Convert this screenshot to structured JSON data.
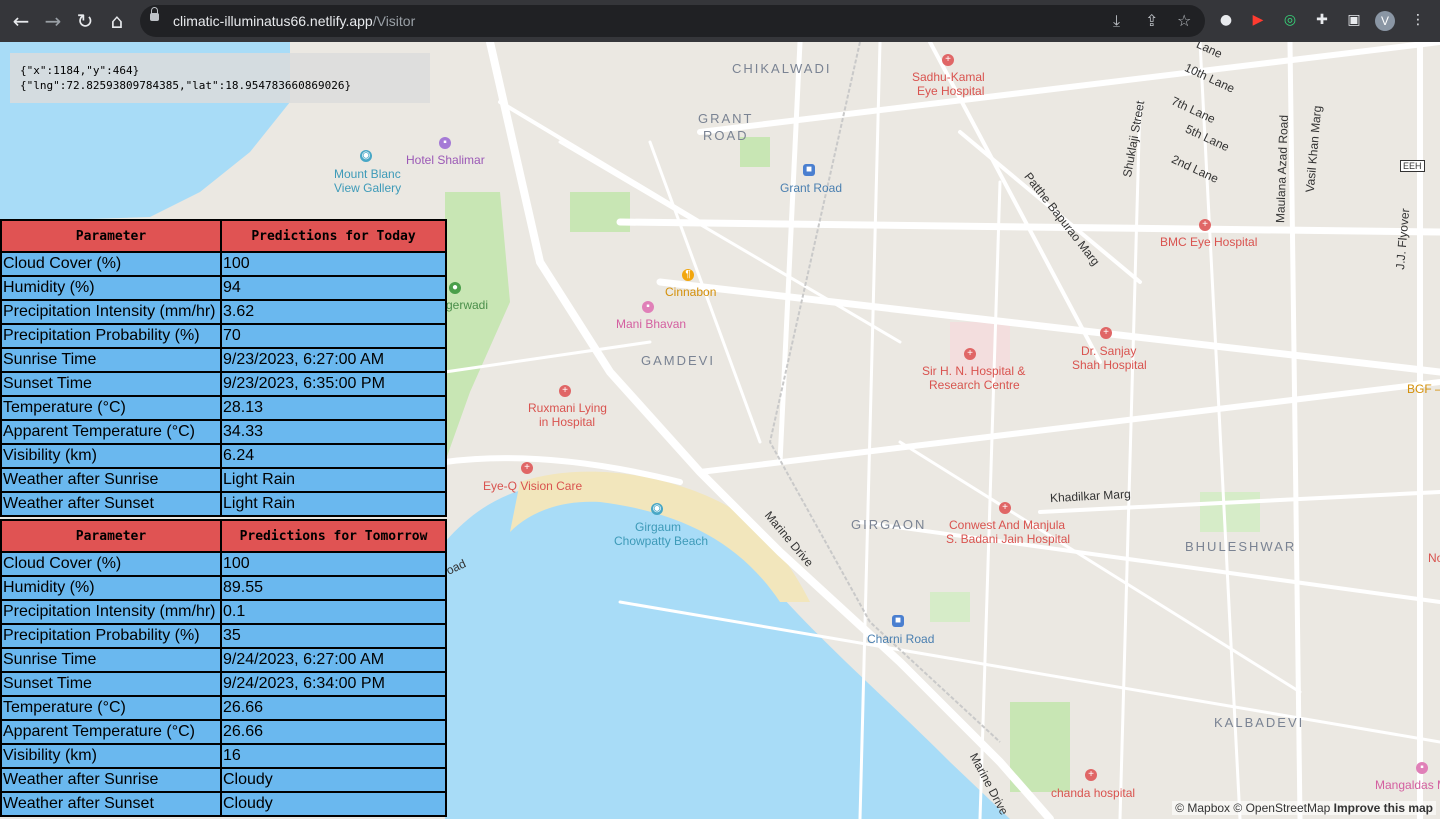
{
  "browser": {
    "url_host": "climatic-illuminatus66.netlify.app",
    "url_path": "/Visitor",
    "profile_initial": "V",
    "icons": [
      "back-icon",
      "forward-icon",
      "reload-icon",
      "home-icon",
      "install-icon",
      "share-icon",
      "star-icon",
      "extension-icon",
      "youtube-icon",
      "target-icon",
      "puzzle-icon",
      "sidepanel-icon",
      "menu-icon"
    ]
  },
  "coords": {
    "line1": "{\"x\":1184,\"y\":464}",
    "line2": "{\"lng\":72.82593809784385,\"lat\":18.954783660869026}"
  },
  "today": {
    "headers": [
      "Parameter",
      "Predictions for Today"
    ],
    "rows": [
      [
        "Cloud Cover (%)",
        "100"
      ],
      [
        "Humidity (%)",
        "94"
      ],
      [
        "Precipitation Intensity (mm/hr)",
        "3.62"
      ],
      [
        "Precipitation Probability (%)",
        "70"
      ],
      [
        "Sunrise Time",
        "9/23/2023, 6:27:00 AM"
      ],
      [
        "Sunset Time",
        "9/23/2023, 6:35:00 PM"
      ],
      [
        "Temperature (°C)",
        "28.13"
      ],
      [
        "Apparent Temperature (°C)",
        "34.33"
      ],
      [
        "Visibility (km)",
        "6.24"
      ],
      [
        "Weather after Sunrise",
        "Light Rain"
      ],
      [
        "Weather after Sunset",
        "Light Rain"
      ]
    ]
  },
  "tomorrow": {
    "headers": [
      "Parameter",
      "Predictions for Tomorrow"
    ],
    "rows": [
      [
        "Cloud Cover (%)",
        "100"
      ],
      [
        "Humidity (%)",
        "89.55"
      ],
      [
        "Precipitation Intensity (mm/hr)",
        "0.1"
      ],
      [
        "Precipitation Probability (%)",
        "35"
      ],
      [
        "Sunrise Time",
        "9/24/2023, 6:27:00 AM"
      ],
      [
        "Sunset Time",
        "9/24/2023, 6:34:00 PM"
      ],
      [
        "Temperature (°C)",
        "26.66"
      ],
      [
        "Apparent Temperature (°C)",
        "26.66"
      ],
      [
        "Visibility (km)",
        "16"
      ],
      [
        "Weather after Sunrise",
        "Cloudy"
      ],
      [
        "Weather after Sunset",
        "Cloudy"
      ]
    ]
  },
  "map": {
    "districts": [
      "CHIKALWADI",
      "GRANT",
      "ROAD",
      "GAMDEVI",
      "GIRGAON",
      "BHULESHWAR",
      "KALBADEVI"
    ],
    "pois": {
      "sadhu_kamal_1": "Sadhu-Kamal",
      "sadhu_kamal_2": "Eye Hospital",
      "hotel_shalimar": "Hotel Shalimar",
      "mount_blanc_1": "Mount Blanc",
      "mount_blanc_2": "View Gallery",
      "grant_road_stn": "Grant Road",
      "bmc_eye": "BMC Eye Hospital",
      "cinnabon": "Cinnabon",
      "mani_bhavan": "Mani Bhavan",
      "hn_hospital_1": "Sir H. N. Hospital &",
      "hn_hospital_2": "Research Centre",
      "sanjay_1": "Dr. Sanjay",
      "sanjay_2": "Shah Hospital",
      "ruxmani_1": "Ruxmani Lying",
      "ruxmani_2": "in Hospital",
      "eyeq": "Eye-Q Vision Care",
      "girgaum_1": "Girgaum",
      "girgaum_2": "Chowpatty Beach",
      "conwest_1": "Conwest And Manjula",
      "conwest_2": "S. Badani Jain Hospital",
      "charni": "Charni Road",
      "chanda": "chanda hospital",
      "mangaldas": "Mangaldas M",
      "gerwadi": "gerwadi",
      "bgf": "BGF –",
      "no": "No",
      "eeh": "EEH"
    },
    "roads": {
      "lane10": "10th Lane",
      "lane7": "7th Lane",
      "lane5": "5th Lane",
      "lane2": "2nd Lane",
      "lane_top": "Lane",
      "shuklaji": "Shuklaji Street",
      "maulana": "Maulana Azad Road",
      "vasil": "Vasil Khan Marg",
      "patthe": "Patthe Bapurao Marg",
      "jj": "J.J. Flyover",
      "khadilkar": "Khadilkar Marg",
      "marine1": "Marine Drive",
      "marine2": "Marine Drive",
      "road_frag": "oad"
    },
    "attribution": {
      "mapbox": "© Mapbox",
      "osm": "© OpenStreetMap",
      "improve": "Improve this map"
    },
    "colors": {
      "water": "#a8dcf7",
      "land": "#ebe8e2",
      "park": "#c8e6b4",
      "beach": "#f2e6bc"
    }
  }
}
